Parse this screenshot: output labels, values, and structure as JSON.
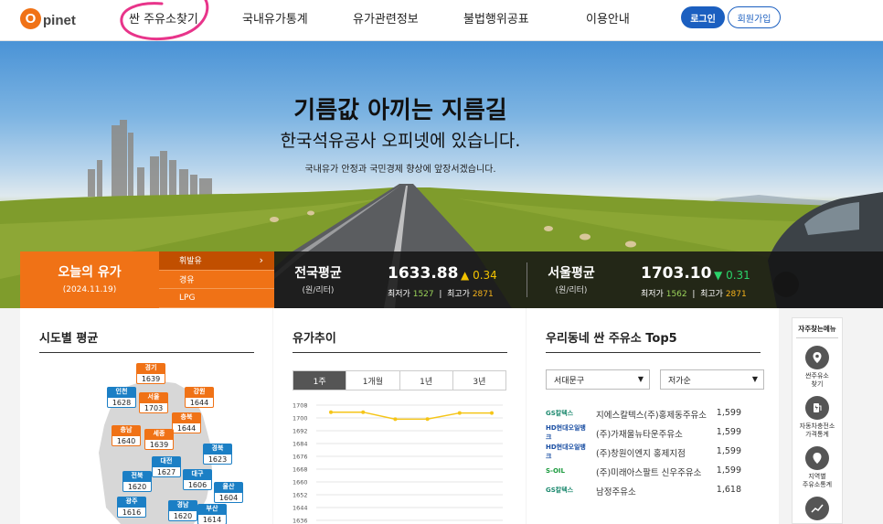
{
  "header": {
    "logo_letter": "O",
    "logo_text": "pinet",
    "nav": [
      "싼 주유소찾기",
      "국내유가통계",
      "유가관련정보",
      "불법행위공표",
      "이용안내"
    ],
    "login_label": "로그인",
    "join_label": "회원가입"
  },
  "hero": {
    "title": "기름값 아끼는 지름길",
    "subtitle": "한국석유공사 오피넷에 있습니다.",
    "description": "국내유가 안정과 국민경제 향상에 앞장서겠습니다."
  },
  "today": {
    "title": "오늘의 유가",
    "date": "(2024.11.19)",
    "fuels": [
      "휘발유",
      "경유",
      "LPG"
    ],
    "active_fuel": "휘발유"
  },
  "national": {
    "label": "전국평균",
    "unit": "(원/리터)",
    "value": "1633.88",
    "change": "0.34",
    "direction": "up",
    "low_label": "최저가",
    "low": "1527",
    "high_label": "최고가",
    "high": "2871"
  },
  "seoul": {
    "label": "서울평균",
    "unit": "(원/리터)",
    "value": "1703.10",
    "change": "0.31",
    "direction": "down",
    "low_label": "최저가",
    "low": "1562",
    "high_label": "최고가",
    "high": "2871"
  },
  "regions_panel": {
    "title": "시도별 평균",
    "regions": [
      {
        "name": "경기",
        "value": "1639",
        "color": "orange"
      },
      {
        "name": "인천",
        "value": "1628",
        "color": "blue"
      },
      {
        "name": "서울",
        "value": "1703",
        "color": "orange"
      },
      {
        "name": "강원",
        "value": "1644",
        "color": "orange"
      },
      {
        "name": "충북",
        "value": "1644",
        "color": "orange"
      },
      {
        "name": "충남",
        "value": "1640",
        "color": "orange"
      },
      {
        "name": "세종",
        "value": "1639",
        "color": "orange"
      },
      {
        "name": "경북",
        "value": "1623",
        "color": "blue"
      },
      {
        "name": "대전",
        "value": "1627",
        "color": "blue"
      },
      {
        "name": "전북",
        "value": "1620",
        "color": "blue"
      },
      {
        "name": "대구",
        "value": "1606",
        "color": "blue"
      },
      {
        "name": "울산",
        "value": "1604",
        "color": "blue"
      },
      {
        "name": "광주",
        "value": "1616",
        "color": "blue"
      },
      {
        "name": "경남",
        "value": "1620",
        "color": "blue"
      },
      {
        "name": "부산",
        "value": "1614",
        "color": "blue"
      }
    ]
  },
  "trend_panel": {
    "title": "유가추이",
    "tabs": [
      "1주",
      "1개월",
      "1년",
      "3년"
    ],
    "active_tab": "1주"
  },
  "chart_data": {
    "type": "line",
    "title": "",
    "xlabel": "",
    "ylabel": "",
    "y_ticks": [
      1708,
      1700,
      1692,
      1684,
      1676,
      1668,
      1660,
      1652,
      1644,
      1636
    ],
    "ylim": [
      1636,
      1708
    ],
    "series": [
      {
        "values": [
          1703.6,
          1703.6,
          1699.2,
          1699.3,
          1703.1,
          1703.1
        ],
        "color": "#f5c518"
      }
    ],
    "grid": true
  },
  "top5_panel": {
    "title": "우리동네 싼 주유소 Top5",
    "district": "서대문구",
    "sort": "저가순",
    "stations": [
      {
        "brand": "GS칼텍스",
        "brand_color": "#1f8a70",
        "name": "지에스칼텍스(주)홍제동주유소",
        "price": "1,599"
      },
      {
        "brand": "HD현대오일뱅크",
        "brand_color": "#1b4fa3",
        "name": "(주)가재울뉴타운주유소",
        "price": "1,599"
      },
      {
        "brand": "HD현대오일뱅크",
        "brand_color": "#1b4fa3",
        "name": "(주)창원이엔지 홍제지점",
        "price": "1,599"
      },
      {
        "brand": "S-OIL",
        "brand_color": "#1a9a3d",
        "name": "(주)미래아스팔트 신우주유소",
        "price": "1,599"
      },
      {
        "brand": "GS칼텍스",
        "brand_color": "#1f8a70",
        "name": "남정주유소",
        "price": "1,618"
      }
    ]
  },
  "quick_menu": {
    "title": "자주찾는메뉴",
    "items": [
      {
        "label": "싼주유소\n찾기",
        "icon": "fuel-pin-icon"
      },
      {
        "label": "자동차충전소\n가격통계",
        "icon": "charger-icon"
      },
      {
        "label": "지역별\n주유소통계",
        "icon": "region-pin-icon"
      },
      {
        "label": "",
        "icon": "trend-icon"
      }
    ]
  }
}
